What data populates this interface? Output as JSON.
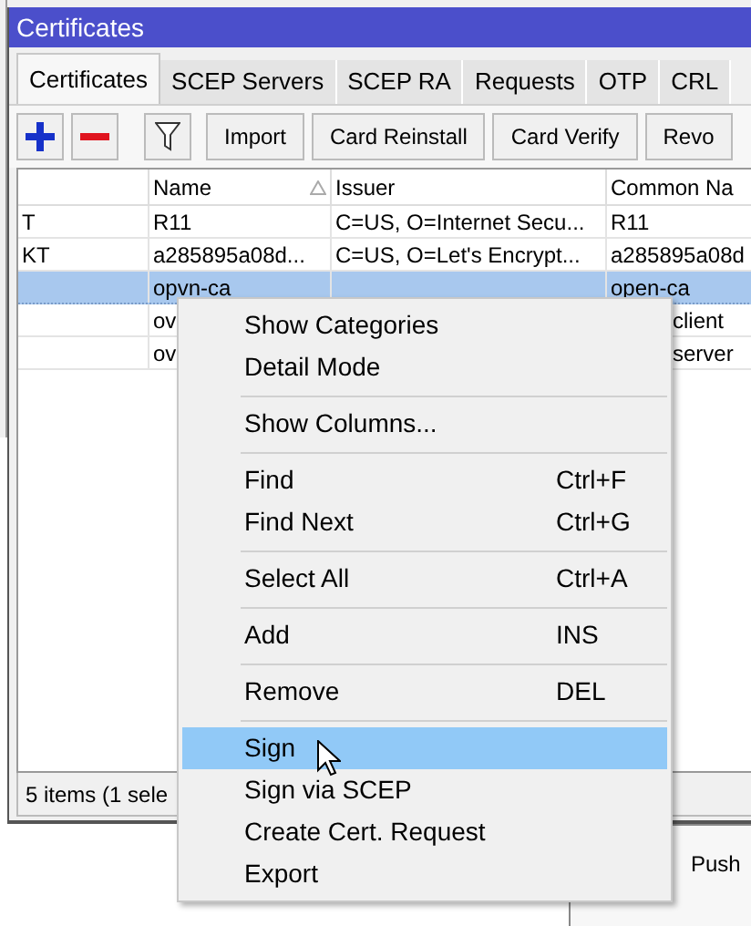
{
  "window": {
    "title": "Certificates"
  },
  "tabs": [
    {
      "label": "Certificates",
      "selected": true
    },
    {
      "label": "SCEP Servers",
      "selected": false
    },
    {
      "label": "SCEP RA",
      "selected": false
    },
    {
      "label": "Requests",
      "selected": false
    },
    {
      "label": "OTP",
      "selected": false
    },
    {
      "label": "CRL",
      "selected": false
    }
  ],
  "toolbar": {
    "buttons": [
      "Import",
      "Card Reinstall",
      "Card Verify",
      "Revo"
    ]
  },
  "table": {
    "columns": [
      {
        "label": "Name",
        "sorted": true
      },
      {
        "label": "Issuer",
        "sorted": false
      },
      {
        "label": "Common Na",
        "sorted": false
      }
    ],
    "rows": [
      {
        "flags": "T",
        "name": "R11",
        "issuer": "C=US, O=Internet Secu...",
        "common_name": "R11",
        "selected": false
      },
      {
        "flags": "KT",
        "name": "a285895a08d...",
        "issuer": "C=US, O=Let's Encrypt...",
        "common_name": "a285895a08d",
        "selected": false
      },
      {
        "name": "opvn-ca",
        "common_name": "open-ca",
        "selected": true
      },
      {
        "name": "ov",
        "common_name": "client",
        "selected": false,
        "under_menu": true
      },
      {
        "name": "ov",
        "common_name": "server",
        "selected": false,
        "under_menu": true
      }
    ]
  },
  "status_bar": "5 items (1 sele",
  "background_panel": {
    "text": "Push"
  },
  "context_menu": [
    {
      "kind": "item",
      "label": "Show Categories",
      "selected": false
    },
    {
      "kind": "item",
      "label": "Detail Mode",
      "selected": false
    },
    {
      "kind": "separator"
    },
    {
      "kind": "item",
      "label": "Show Columns...",
      "selected": false
    },
    {
      "kind": "separator"
    },
    {
      "kind": "item",
      "label": "Find",
      "shortcut": "Ctrl+F",
      "selected": false
    },
    {
      "kind": "item",
      "label": "Find Next",
      "shortcut": "Ctrl+G",
      "selected": false
    },
    {
      "kind": "separator"
    },
    {
      "kind": "item",
      "label": "Select All",
      "shortcut": "Ctrl+A",
      "selected": false
    },
    {
      "kind": "separator"
    },
    {
      "kind": "item",
      "label": "Add",
      "shortcut": "INS",
      "selected": false
    },
    {
      "kind": "separator"
    },
    {
      "kind": "item",
      "label": "Remove",
      "shortcut": "DEL",
      "selected": false
    },
    {
      "kind": "separator"
    },
    {
      "kind": "item",
      "label": "Sign",
      "selected": true
    },
    {
      "kind": "item",
      "label": "Sign via SCEP",
      "selected": false
    },
    {
      "kind": "item",
      "label": "Create Cert. Request",
      "selected": false
    },
    {
      "kind": "item",
      "label": "Export",
      "selected": false
    }
  ]
}
